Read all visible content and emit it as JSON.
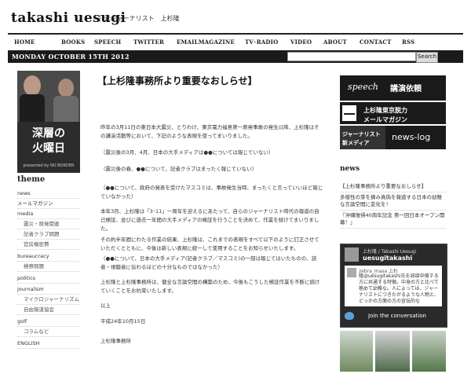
{
  "site": {
    "logo": "takashi uesugi",
    "tagline": "元ジャーナリスト　上杉隆"
  },
  "nav": {
    "items": [
      "HOME",
      "BOOKS",
      "SPEECH",
      "TWITTER",
      "EMAILMAGAZINE",
      "TV･RADIO",
      "VIDEO",
      "ABOUT",
      "CONTACT",
      "RSS"
    ]
  },
  "datebar": {
    "date": "MONDAY OCTOBER 15TH 2012",
    "search_placeholder": "",
    "search_button": "Search"
  },
  "left": {
    "banner": {
      "badge": "",
      "line1": "深層の",
      "line2": "火曜日",
      "presented": "presented by NO BORDER"
    },
    "theme_title": "theme",
    "categories": [
      {
        "label": "news",
        "sub": false
      },
      {
        "label": "メールマガジン",
        "sub": false
      },
      {
        "label": "media",
        "sub": false
      },
      {
        "label": "震災・原発関連",
        "sub": true
      },
      {
        "label": "記者クラブ問題",
        "sub": true
      },
      {
        "label": "官房機密費",
        "sub": true
      },
      {
        "label": "bureaucracy",
        "sub": false
      },
      {
        "label": "検察問題",
        "sub": true
      },
      {
        "label": "politics",
        "sub": false
      },
      {
        "label": "journalism",
        "sub": false
      },
      {
        "label": "マイクロジャーナリズム",
        "sub": true
      },
      {
        "label": "自由報道協会",
        "sub": true
      },
      {
        "label": "golf",
        "sub": false
      },
      {
        "label": "コラムなど",
        "sub": true
      },
      {
        "label": "ENGLISH",
        "sub": false
      }
    ]
  },
  "main": {
    "title": "【上杉隆事務所より重要なおしらせ】",
    "paragraphs": [
      "昨年の3月11日の東日本大震災、とりわけ、東京電力福島第一原発事故の発生以降、上杉隆はその講演活動等において、下記のような表現を使ってまいりました。",
      "（震災後の3月、4月、日本の大手メディアは●●については報じていない）",
      "（震災後の春、●●について、記者クラブはまったく報じていない）",
      "（●●について、政府の発表を受けたマスコミは、事故発生当時、まったくと言っていいほど報じていなかった）",
      "本年3月、上杉隆は「3･11」一周年を迎えるにあたって、自らのジャーナリスト時代の報道の自己検証、並びに過去一年間の大手メディアの検証を行うことを決めて、作業を続けてまいりました。",
      "その約半年間にわたる作業の結果、上杉隆は、これまでの表現をすべて以下のように訂正させていただくとともに、今後は新しい表現に統一して使用することをお知らせいたします。",
      "（●●について、日本の大手メディア(記者クラブ／マスコミ)の一部は報じてはいたものの、読者・視聴者に伝わるほどの十分なものではなかった）",
      "上杉隆と上杉隆事務所は、健全な言論空間の構築のため、今後もこうした検証作業を不断に続けていくことをお約束いたします。",
      "以上",
      "平成24年10月15日",
      "上杉隆事務所"
    ]
  },
  "right": {
    "speech": {
      "en": "speech",
      "ja": "講演依頼"
    },
    "mail": {
      "line1": "上杉隆東京脱力",
      "line2": "メールマガジン"
    },
    "newslog": {
      "line1": "ジャーナリスト",
      "line2": "新メディア",
      "label": "news-log"
    },
    "news_title": "news",
    "news_items": [
      "【上杉隆事務所より重要なおしらせ】",
      "多様性の芽を摘み真偽を報道する日本の幼稚な言論空間に変化を！",
      "『沖縄復帰40周年記念 第一回日本オープン開幕！』"
    ],
    "twitter": {
      "name": "上杉隆 / Takashi Uesugi",
      "handle": "uesugitakashi",
      "tweet_user": "zebra_masa 上杉",
      "tweet_text": "隆@uesugitakashi氏を誹謗中傷する方に共通する特徴。中身の方と比べて極めて幼稚な。人によっては、ジャーナリストにつきたがるような人物と、どっかの方面の方の宣伝的な",
      "join": "Join the conversation"
    }
  }
}
